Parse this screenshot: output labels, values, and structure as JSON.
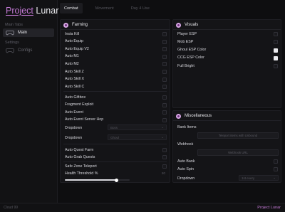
{
  "app": {
    "title_part1": "Project",
    "title_part2": "Lunar"
  },
  "sidebar": {
    "section1": "Main Tabs",
    "main_item": "Main",
    "section2": "Settings",
    "config_item": "Configs"
  },
  "tabs": [
    "Combat",
    "Movement",
    "Day 4 Use"
  ],
  "farming": {
    "title": "Farming",
    "toggles": [
      {
        "label": "Insta Kill",
        "on": false
      },
      {
        "label": "Auto Equip",
        "on": false
      },
      {
        "label": "Auto Equip V2",
        "on": false
      },
      {
        "label": "Auto M1",
        "on": false
      },
      {
        "label": "Auto M2",
        "on": false
      },
      {
        "label": "Auto Skill Z",
        "on": false
      },
      {
        "label": "Auto Skill X",
        "on": false
      },
      {
        "label": "Auto Skill C",
        "on": false
      }
    ],
    "toggles2": [
      {
        "label": "Auto Giftbox",
        "on": false
      },
      {
        "label": "Fragment Exploit",
        "on": false
      },
      {
        "label": "Auto Event",
        "on": false
      },
      {
        "label": "Auto Event Server Hop",
        "on": false
      }
    ],
    "dropdown1": {
      "label": "Dropdown",
      "value": "Boss"
    },
    "dropdown2": {
      "label": "Dropdown",
      "value": "Ghoul"
    },
    "toggles3": [
      {
        "label": "Auto Quest Farm",
        "on": false
      },
      {
        "label": "Auto Grab Quests",
        "on": false
      }
    ],
    "teleport": {
      "label": "Safe Zone Teleport",
      "on": false
    },
    "health": {
      "label": "Health Threshold %",
      "value": "80",
      "fraction": 0.8
    }
  },
  "visuals": {
    "title": "Visuals",
    "toggles": [
      {
        "label": "Player ESP",
        "on": false
      },
      {
        "label": "Mob ESP",
        "on": false
      },
      {
        "label": "Ghoul ESP Color",
        "on": true
      },
      {
        "label": "CCG ESP Color",
        "on": true
      },
      {
        "label": "Full Bright",
        "on": false
      }
    ]
  },
  "misc": {
    "title": "Miscellaneous",
    "bank_label": "Bank Items",
    "bank_button": "Teleport items with Unbound",
    "webhook_label": "Webhook",
    "webhook_button": "Webhook URL",
    "toggles": [
      {
        "label": "Auto Bank",
        "on": false
      },
      {
        "label": "Auto Spin",
        "on": false
      }
    ],
    "dropdown": {
      "label": "Dropdown",
      "value": "1st every"
    }
  },
  "footer": {
    "left": "Cloud 99",
    "right": "Project Lunar"
  },
  "colors": {
    "accent": "#c47ad6",
    "background": "#0e0e10",
    "panel": "#141417"
  }
}
